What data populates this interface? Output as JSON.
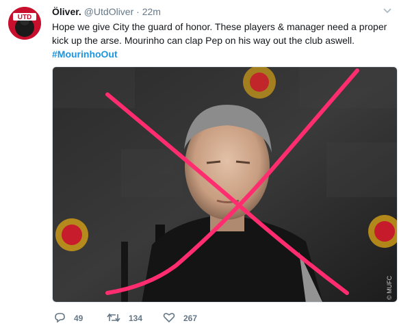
{
  "tweet": {
    "author_name": "Öliver.",
    "author_handle": "@UtdOliver",
    "separator": "·",
    "time_ago": "22m",
    "text": "Hope we give City the guard of honor. These players & manager need a proper kick up the arse. Mourinho can clap Pep on his way out the club aswell.",
    "hashtag": "#MourinhoOut",
    "avatar_badge": "UTD",
    "media_watermark": "© MUFC",
    "stats": {
      "replies": "49",
      "retweets": "134",
      "likes": "267"
    }
  },
  "colors": {
    "link": "#1b95e0",
    "muted": "#657786",
    "cross": "#ff2d6f",
    "avatar": "#c8102e"
  },
  "icons": [
    "chevron-down-icon",
    "reply-icon",
    "retweet-icon",
    "heart-icon"
  ]
}
